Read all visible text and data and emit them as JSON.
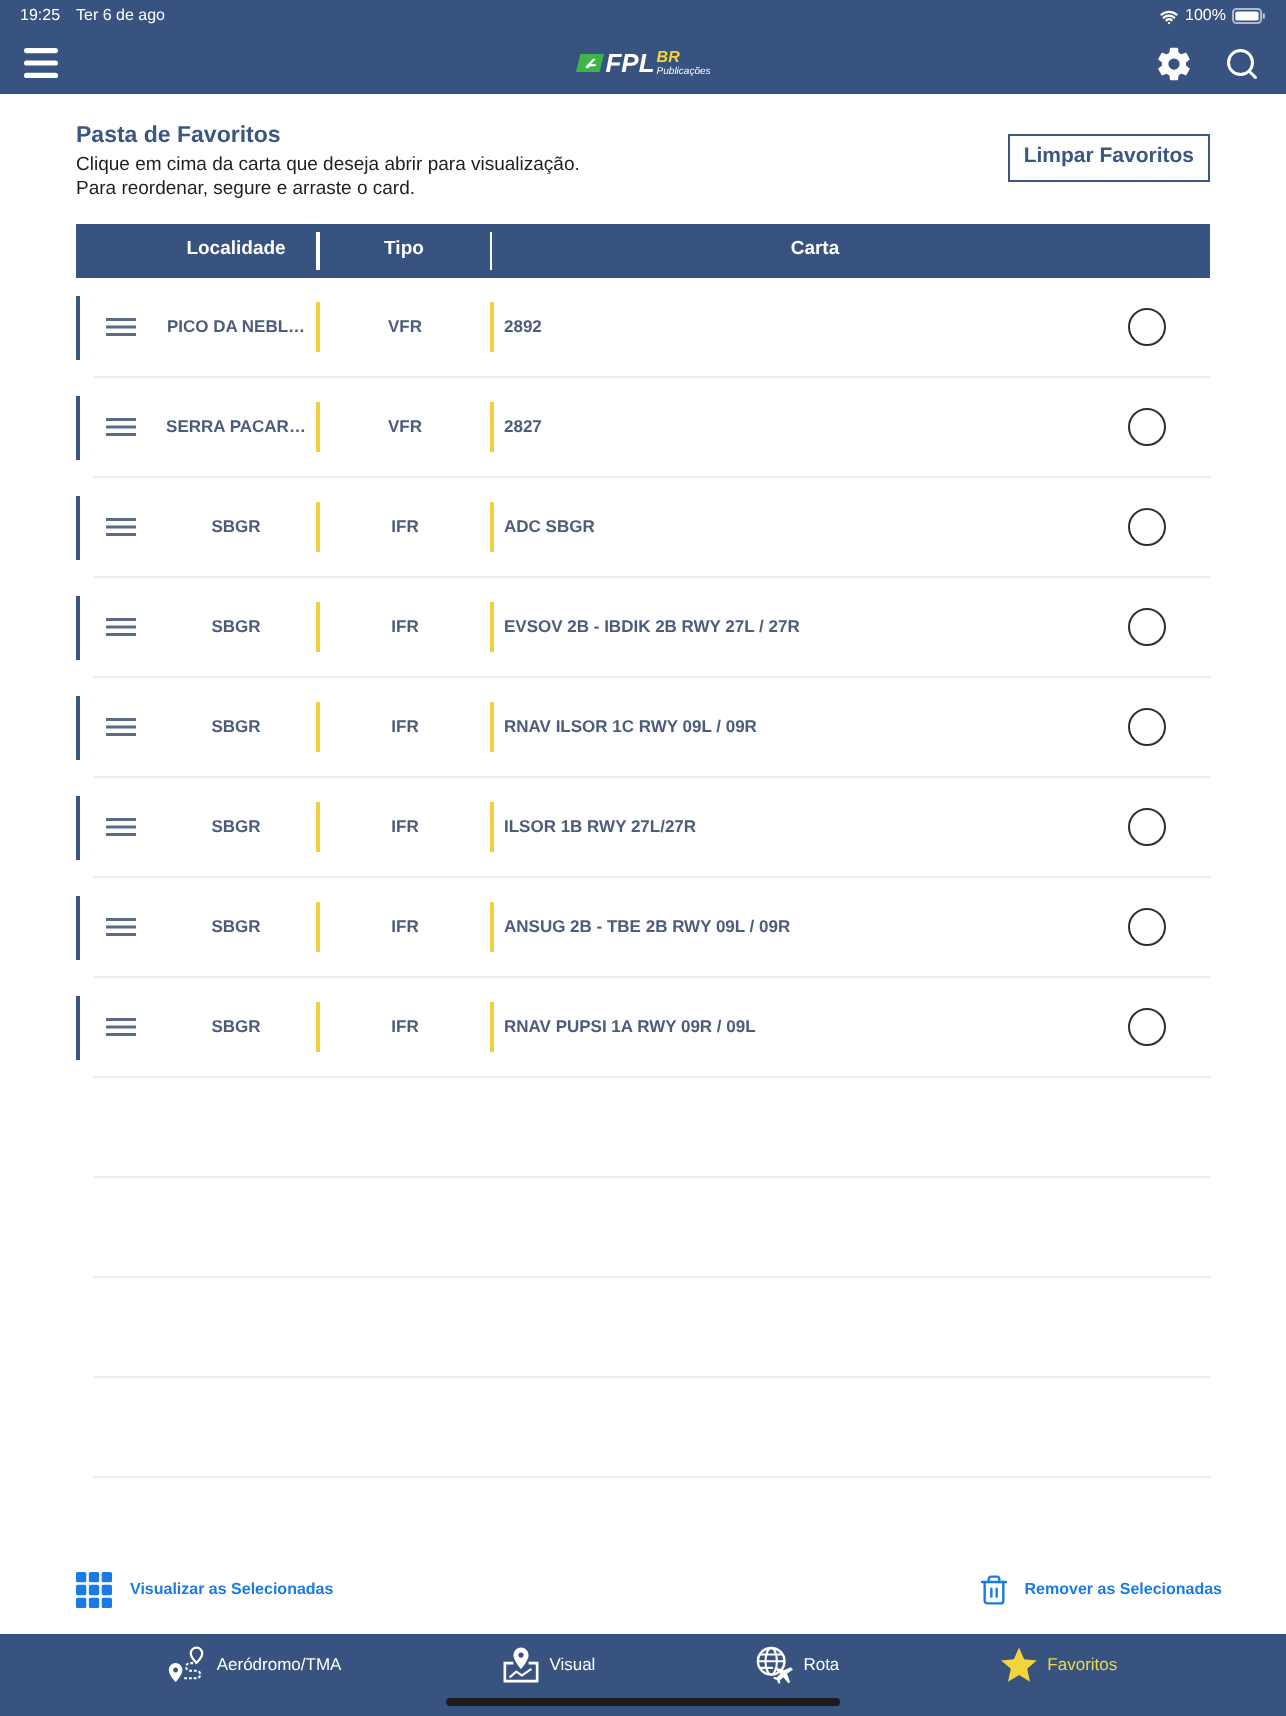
{
  "status_bar": {
    "time": "19:25",
    "date": "Ter 6 de ago",
    "battery": "100%"
  },
  "nav_bar": {
    "logo": {
      "brand": "FPL",
      "suffix": "BR",
      "subtitle": "Publicações"
    }
  },
  "favorites": {
    "title": "Pasta de Favoritos",
    "instructions": [
      "Clique em cima da carta que deseja abrir para visualização.",
      "Para reordenar, segure e arraste o card."
    ],
    "clear_button": "Limpar Favoritos"
  },
  "table": {
    "columns": [
      "Localidade",
      "Tipo",
      "Carta"
    ],
    "rows": [
      {
        "location": "PICO DA NEBL…",
        "type": "VFR",
        "chart": "2892",
        "selected": false
      },
      {
        "location": "SERRA PACAR…",
        "type": "VFR",
        "chart": "2827",
        "selected": false
      },
      {
        "location": "SBGR",
        "type": "IFR",
        "chart": "ADC SBGR",
        "selected": false
      },
      {
        "location": "SBGR",
        "type": "IFR",
        "chart": "EVSOV 2B - IBDIK 2B RWY 27L / 27R",
        "selected": false
      },
      {
        "location": "SBGR",
        "type": "IFR",
        "chart": "RNAV ILSOR 1C RWY 09L / 09R",
        "selected": false
      },
      {
        "location": "SBGR",
        "type": "IFR",
        "chart": "ILSOR 1B RWY 27L/27R",
        "selected": false
      },
      {
        "location": "SBGR",
        "type": "IFR",
        "chart": "ANSUG 2B - TBE 2B RWY 09L / 09R",
        "selected": false
      },
      {
        "location": "SBGR",
        "type": "IFR",
        "chart": "RNAV PUPSI 1A RWY 09R / 09L",
        "selected": false
      }
    ]
  },
  "actions": [
    {
      "kind": "view",
      "label": "Visualizar as Selecionadas"
    },
    {
      "kind": "remove",
      "label": "Remover as Selecionadas"
    }
  ],
  "tab_bar": [
    {
      "kind": "aerodrome",
      "label": "Aeródromo/TMA",
      "selected": false
    },
    {
      "kind": "visual",
      "label": "Visual",
      "selected": false
    },
    {
      "kind": "route",
      "label": "Rota",
      "selected": false
    },
    {
      "kind": "favorites",
      "label": "Favoritos",
      "selected": true
    }
  ]
}
